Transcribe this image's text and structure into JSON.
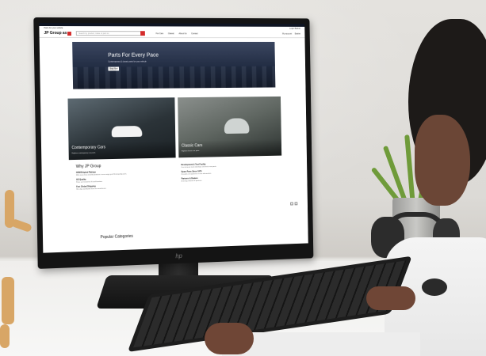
{
  "site": {
    "top_notice": "Parts for your vehicle",
    "top_links": [
      "Login",
      "Basket"
    ],
    "logo_text": "JP Group as",
    "search_placeholder": "Search by product, make or part no.",
    "nav": [
      "For Cars",
      "Classic",
      "About Us",
      "Contact"
    ],
    "header_right": [
      "My account",
      "Basket"
    ]
  },
  "hero": {
    "title": "Parts For Every Pace",
    "subtitle": "Contemporary & classic parts for your vehicle",
    "button": "Shop Now"
  },
  "cards": [
    {
      "title": "Contemporary Cars",
      "subtitle": "Explore contemporary car parts"
    },
    {
      "title": "Classic Cars",
      "subtitle": "Explore classic car parts"
    }
  ],
  "why": {
    "title": "Why JP Group",
    "items_left": [
      {
        "heading": "OEM/Original Ratings",
        "text": "With more than 20,000 products in our range you'll find quality parts."
      },
      {
        "heading": "OE Quality",
        "text": "Parts are tested for fit and function."
      },
      {
        "heading": "Fast Global Shipping",
        "text": "We ship worldwide from our warehouse."
      }
    ],
    "items_right": [
      {
        "heading": "Development & Test Facility",
        "text": "Our in-house team develops and tests new parts."
      },
      {
        "heading": "Spare Parts Since 1974",
        "text": "Decades of experience in the aftermarket."
      },
      {
        "heading": "Partners & Dealers",
        "text": "A strong network of partners."
      }
    ]
  },
  "popular_title": "Popular Categories",
  "monitor_brand": "hp"
}
